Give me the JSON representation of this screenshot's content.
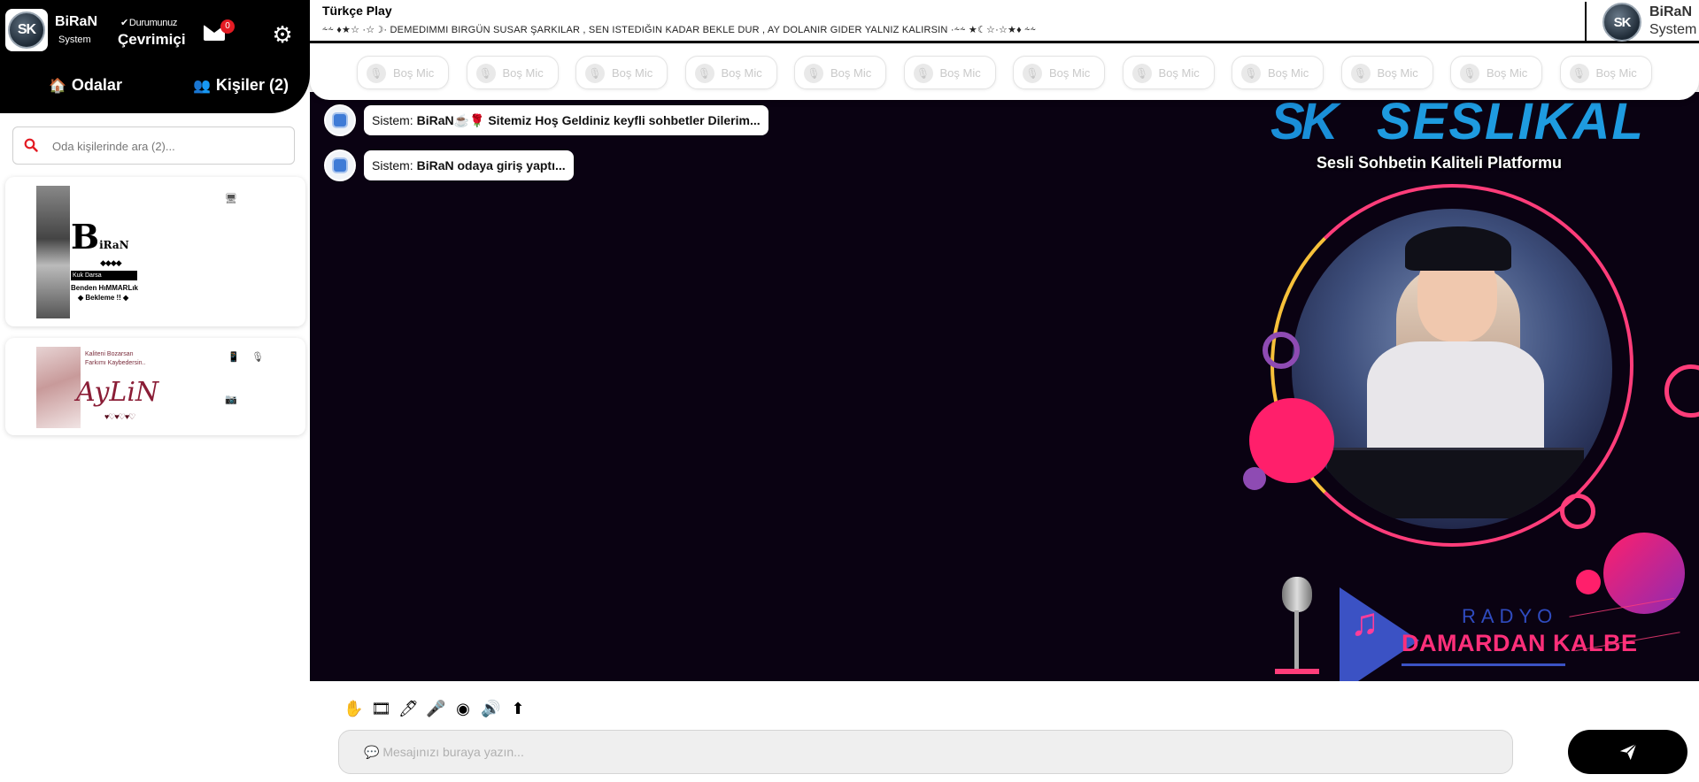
{
  "user": {
    "name": "BiRaN",
    "role": "System",
    "logo_text": "SK"
  },
  "status": {
    "label": "Durumunuz",
    "value": "Çevrimiçi"
  },
  "mail": {
    "count": "0"
  },
  "tabs": {
    "rooms": "Odalar",
    "people": "Kişiler (2)"
  },
  "search": {
    "placeholder": "Oda kişilerinde ara (2)..."
  },
  "users": [
    {
      "big_letter": "B",
      "name_rest": "iRaN",
      "deco": "◆◆◆◆",
      "bar_text": "Kuk Darsa",
      "motto_1": "Benden HıMMARLık",
      "motto_2": "◆ Bekleme !! ◆"
    },
    {
      "motto": "Kaliteni Bozarsan\nFarkımı Kaybedersin..",
      "name": "AyLiN",
      "hearts": "♥♡♥♡♥♡"
    }
  ],
  "room": {
    "title": "Türkçe Play",
    "song": "DEMEDIMMI BIRGÜN SUSAR ŞARKILAR , SEN ISTEDIĞIN KADAR BEKLE DUR , AY DOLANIR GIDER YALNIZ KALIRSIN",
    "song_prefix": "⸞⸞ ♦★☆ ·☆☽·",
    "song_suffix": "·⸞⸞ ★☾☆·☆★♦ ⸞⸞"
  },
  "mic_slots": [
    "Boş Mic",
    "Boş Mic",
    "Boş Mic",
    "Boş Mic",
    "Boş Mic",
    "Boş Mic",
    "Boş Mic",
    "Boş Mic",
    "Boş Mic",
    "Boş Mic",
    "Boş Mic",
    "Boş Mic"
  ],
  "messages": [
    {
      "sender": "Sistem:",
      "text": "BiRaN☕🌹 Sitemiz Hoş Geldiniz keyfli sohbetler Dilerim..."
    },
    {
      "sender": "Sistem:",
      "text": "BiRaN odaya giriş yaptı..."
    }
  ],
  "art": {
    "brand_sk": "SK",
    "brand_name": "SESLIKAL",
    "tagline": "Sesli Sohbetin Kaliteli Platformu",
    "radio_label": "RADYO",
    "radio_name": "DAMARDAN KALBE"
  },
  "toolbar_icons": [
    "hand-icon",
    "film-icon",
    "draw-icon",
    "microphone-icon",
    "webcam-icon",
    "speaker-icon",
    "upload-icon"
  ],
  "composer": {
    "placeholder": "💬 Mesajınızı buraya yazın..."
  },
  "colors": {
    "accent": "#000000",
    "badge": "#e31b23",
    "search_icon": "#e31b23",
    "stage_bg": "#0a0212"
  }
}
